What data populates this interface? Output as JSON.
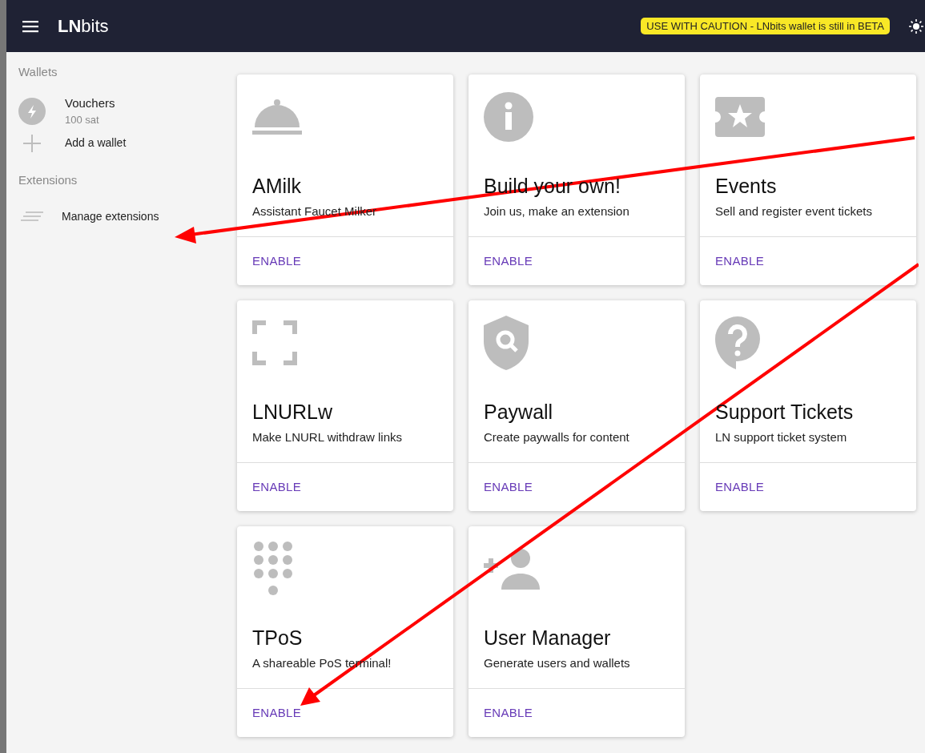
{
  "header": {
    "brand_bold": "LN",
    "brand_rest": "bits",
    "warning": "USE WITH CAUTION - LNbits wallet is still in BETA"
  },
  "sidebar": {
    "wallets_title": "Wallets",
    "wallets": [
      {
        "name": "Vouchers",
        "balance": "100 sat"
      }
    ],
    "add_wallet": "Add a wallet",
    "extensions_title": "Extensions",
    "manage_extensions": "Manage extensions"
  },
  "extensions": [
    {
      "title": "AMilk",
      "description": "Assistant Faucet Milker",
      "action": "ENABLE"
    },
    {
      "title": "Build your own!",
      "description": "Join us, make an extension",
      "action": "ENABLE"
    },
    {
      "title": "Events",
      "description": "Sell and register event tickets",
      "action": "ENABLE"
    },
    {
      "title": "LNURLw",
      "description": "Make LNURL withdraw links",
      "action": "ENABLE"
    },
    {
      "title": "Paywall",
      "description": "Create paywalls for content",
      "action": "ENABLE"
    },
    {
      "title": "Support Tickets",
      "description": "LN support ticket system",
      "action": "ENABLE"
    },
    {
      "title": "TPoS",
      "description": "A shareable PoS terminal!",
      "action": "ENABLE"
    },
    {
      "title": "User Manager",
      "description": "Generate users and wallets",
      "action": "ENABLE"
    }
  ]
}
